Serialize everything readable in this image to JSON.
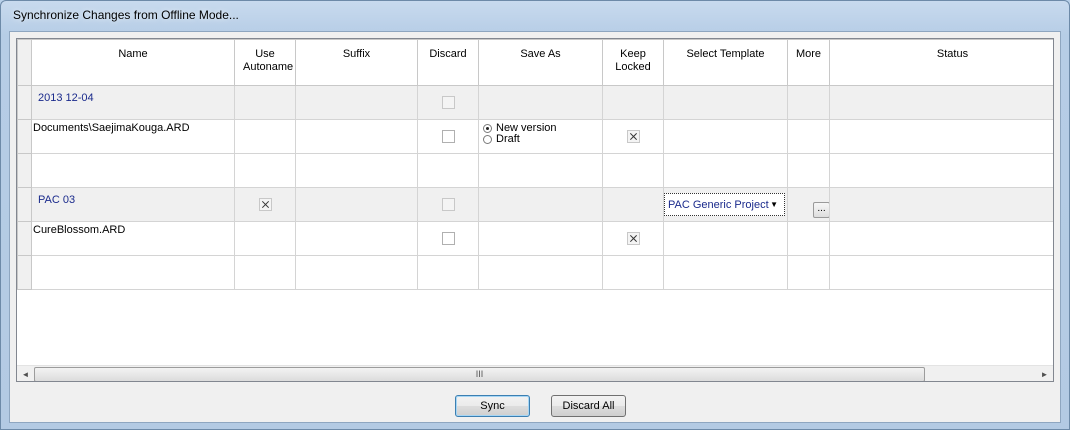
{
  "window": {
    "title": "Synchronize Changes from Offline Mode..."
  },
  "columns": [
    "Name",
    "Use Autoname",
    "Suffix",
    "Discard",
    "Save As",
    "Keep Locked",
    "Select Template",
    "More",
    "Status"
  ],
  "rows": [
    {
      "kind": "group",
      "name": "2013 12-04",
      "use_autoname": null,
      "discard": false,
      "discard_enabled": false,
      "template": "",
      "more": ""
    },
    {
      "kind": "file",
      "name": "Documents\\SaejimaKouga.ARD",
      "discard": false,
      "save_as_options": [
        "New version",
        "Draft"
      ],
      "save_as_selected": "New version",
      "keep_locked": true
    },
    {
      "kind": "empty"
    },
    {
      "kind": "group",
      "name": "PAC 03",
      "use_autoname": true,
      "discard": false,
      "discard_enabled": false,
      "template": "PAC Generic Project",
      "more": "..."
    },
    {
      "kind": "file",
      "name": "CureBlossom.ARD",
      "discard": false,
      "save_as_options": [],
      "keep_locked": true
    },
    {
      "kind": "empty"
    }
  ],
  "scrollbar": {
    "left_arrow": "◄",
    "right_arrow": "►",
    "grip": "III"
  },
  "icons": {
    "dropdown": "chevron-down-icon"
  },
  "buttons": {
    "sync": "Sync",
    "discard_all": "Discard All"
  }
}
